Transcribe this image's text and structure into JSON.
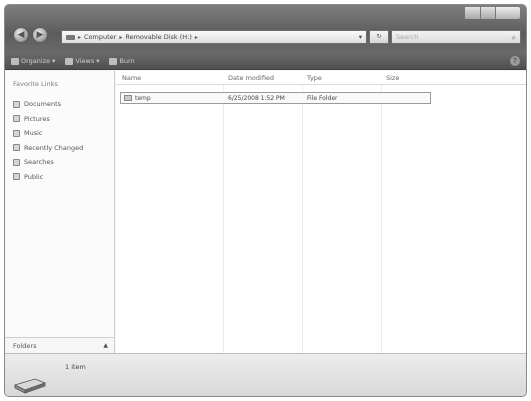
{
  "window": {
    "address": {
      "crumbs": [
        "Computer",
        "Removable Disk (H:)"
      ]
    },
    "search_placeholder": "Search",
    "refresh_label": "↻"
  },
  "toolbar": {
    "organize_label": "Organize",
    "views_label": "Views",
    "burn_label": "Burn",
    "help_label": "?"
  },
  "navpane": {
    "title": "Favorite Links",
    "items": [
      {
        "label": "Documents",
        "icon": "documents-icon"
      },
      {
        "label": "Pictures",
        "icon": "pictures-icon"
      },
      {
        "label": "Music",
        "icon": "music-icon"
      },
      {
        "label": "Recently Changed",
        "icon": "recently-changed-icon"
      },
      {
        "label": "Searches",
        "icon": "searches-icon"
      },
      {
        "label": "Public",
        "icon": "public-icon"
      }
    ],
    "folders_label": "Folders"
  },
  "columns": [
    "Name",
    "Date modified",
    "Type",
    "Size"
  ],
  "files": [
    {
      "name": "temp",
      "date_modified": "6/25/2008 1:52 PM",
      "type": "File Folder",
      "size": ""
    }
  ],
  "details": {
    "item_count": "1 item"
  }
}
